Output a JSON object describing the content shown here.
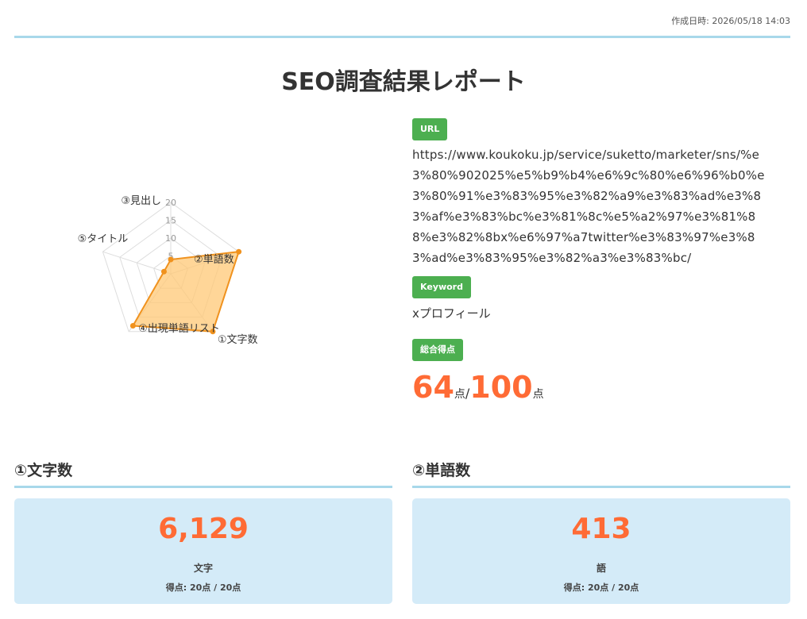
{
  "header": {
    "created_label": "作成日時: 2026/05/18 14:03",
    "title": "SEO調査結果レポート"
  },
  "chart_data": {
    "type": "radar",
    "axes": [
      "①文字数",
      "②単語数",
      "③見出し",
      "⑤タイトル",
      "④出現単語リスト"
    ],
    "ticks": [
      "5",
      "10",
      "15",
      "20"
    ],
    "rmax": 20,
    "values": [
      20,
      20,
      4,
      2,
      18
    ],
    "colors": {
      "fill": "#ffc875",
      "stroke": "#f0921e",
      "grid": "#dddddd"
    }
  },
  "info": {
    "url_badge": "URL",
    "url": "https://www.koukoku.jp/service/suketto/marketer/sns/%e3%80%902025%e5%b9%b4%e6%9c%80%e6%96%b0%e3%80%91%e3%83%95%e3%82%a9%e3%83%ad%e3%83%af%e3%83%bc%e3%81%8c%e5%a2%97%e3%81%88%e3%82%8bx%e6%97%a7twitter%e3%83%97%e3%83%ad%e3%83%95%e3%82%a3%e3%83%bc/",
    "keyword_badge": "Keyword",
    "keyword": "xプロフィール",
    "score_badge": "総合得点",
    "score": "64",
    "score_unit": "点",
    "score_sep": "/",
    "score_max": "100",
    "score_max_unit": "点"
  },
  "sections": {
    "chars": {
      "title": "①文字数",
      "value": "6,129",
      "unit": "文字",
      "score": "得点: 20点 / 20点"
    },
    "words": {
      "title": "②単語数",
      "value": "413",
      "unit": "語",
      "score": "得点: 20点 / 20点"
    }
  }
}
